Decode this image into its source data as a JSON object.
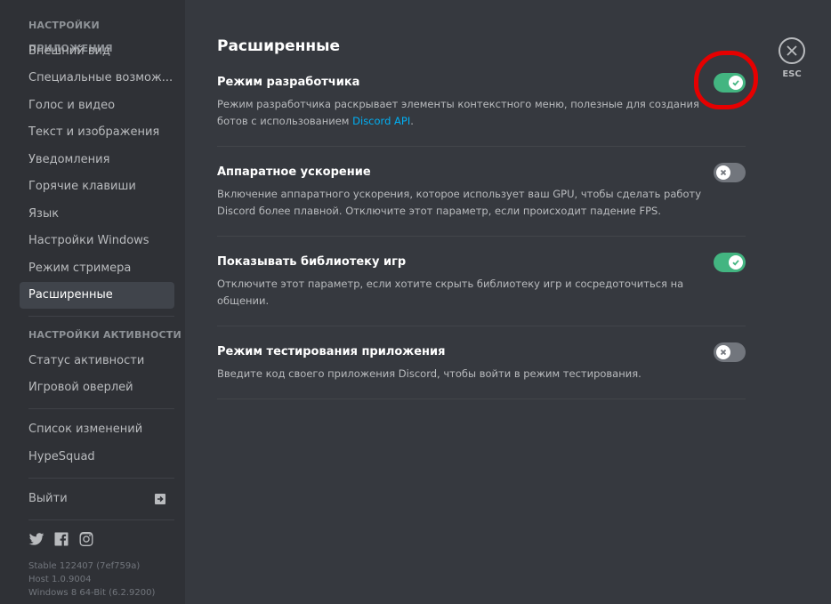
{
  "sidebar": {
    "app_settings_header": "НАСТРОЙКИ ПРИЛОЖЕНИЯ",
    "app_items": [
      {
        "label": "Внешний вид"
      },
      {
        "label": "Специальные возмож..."
      },
      {
        "label": "Голос и видео"
      },
      {
        "label": "Текст и изображения"
      },
      {
        "label": "Уведомления"
      },
      {
        "label": "Горячие клавиши"
      },
      {
        "label": "Язык"
      },
      {
        "label": "Настройки Windows"
      },
      {
        "label": "Режим стримера"
      },
      {
        "label": "Расширенные"
      }
    ],
    "activity_header": "НАСТРОЙКИ АКТИВНОСТИ",
    "activity_items": [
      {
        "label": "Статус активности"
      },
      {
        "label": "Игровой оверлей"
      }
    ],
    "misc_items": [
      {
        "label": "Список изменений"
      },
      {
        "label": "HypeSquad"
      }
    ],
    "logout_label": "Выйти",
    "social_icons": [
      "twitter-icon",
      "facebook-icon",
      "instagram-icon"
    ],
    "build_info": {
      "line1": "Stable 122407 (7ef759a)",
      "line2": "Host 1.0.9004",
      "line3": "Windows 8 64-Bit (6.2.9200)"
    }
  },
  "main": {
    "title": "Расширенные",
    "settings": [
      {
        "title": "Режим разработчика",
        "desc_before": "Режим разработчика раскрывает элементы контекстного меню, полезные для создания ботов с использованием ",
        "desc_link": "Discord API",
        "desc_after": ".",
        "enabled": true
      },
      {
        "title": "Аппаратное ускорение",
        "desc": "Включение аппаратного ускорения, которое использует ваш GPU, чтобы сделать работу Discord более плавной. Отключите этот параметр, если происходит падение FPS.",
        "enabled": false
      },
      {
        "title": "Показывать библиотеку игр",
        "desc": "Отключите этот параметр, если хотите скрыть библиотеку игр и сосредоточиться на общении.",
        "enabled": true
      },
      {
        "title": "Режим тестирования приложения",
        "desc": "Введите код своего приложения Discord, чтобы войти в режим тестирования.",
        "enabled": false
      }
    ]
  },
  "close": {
    "label": "ESC"
  },
  "colors": {
    "toggle_on": "#43b581",
    "toggle_off": "#72767d",
    "highlight": "#e60000",
    "link": "#00b0f4"
  }
}
